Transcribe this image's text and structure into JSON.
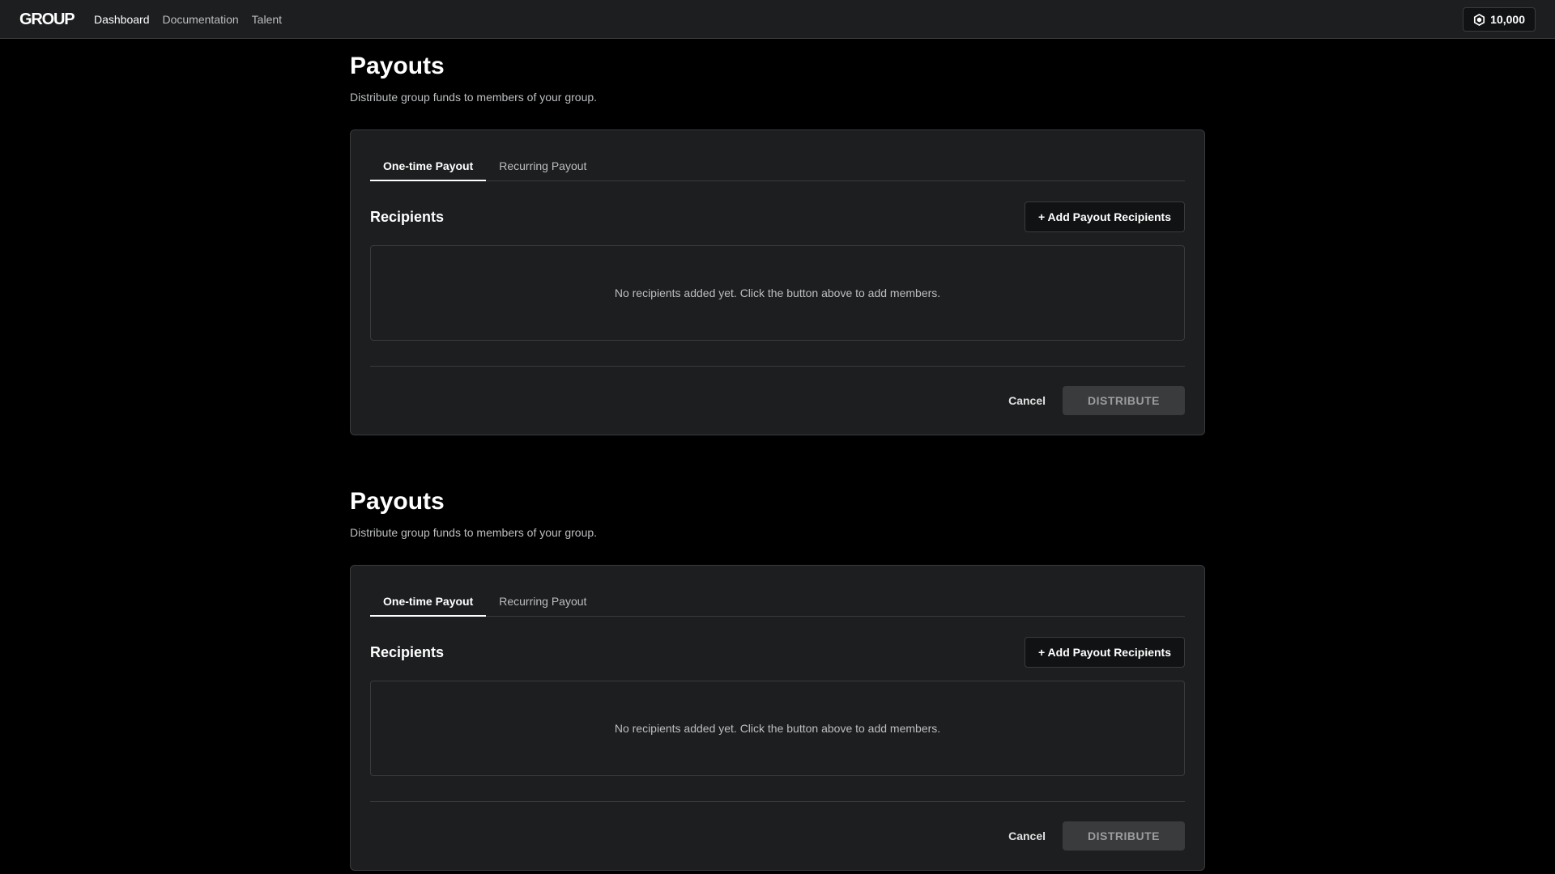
{
  "header": {
    "brand": "GROUP",
    "nav": [
      {
        "label": "Dashboard",
        "active": true
      },
      {
        "label": "Documentation",
        "active": false
      },
      {
        "label": "Talent",
        "active": false
      }
    ],
    "balance": "10,000",
    "balance_icon": "robux-icon"
  },
  "sections": [
    {
      "title": "Payouts",
      "subtitle": "Distribute group funds to members of your group.",
      "tabs": [
        {
          "label": "One-time Payout",
          "active": true
        },
        {
          "label": "Recurring Payout",
          "active": false
        }
      ],
      "recipients_title": "Recipients",
      "add_button": "+ Add Payout Recipients",
      "empty_message": "No recipients added yet. Click the button above to add members.",
      "cancel_label": "Cancel",
      "distribute_label": "DISTRIBUTE"
    },
    {
      "title": "Payouts",
      "subtitle": "Distribute group funds to members of your group.",
      "tabs": [
        {
          "label": "One-time Payout",
          "active": true
        },
        {
          "label": "Recurring Payout",
          "active": false
        }
      ],
      "recipients_title": "Recipients",
      "add_button": "+ Add Payout Recipients",
      "empty_message": "No recipients added yet. Click the button above to add members.",
      "cancel_label": "Cancel",
      "distribute_label": "DISTRIBUTE"
    }
  ],
  "colors": {
    "background": "#000000",
    "surface": "#1d1e20",
    "border": "#393b3d",
    "text_primary": "#ffffff",
    "text_secondary": "#bcbec0",
    "button_disabled_bg": "#393b3d",
    "button_disabled_text": "#9b9d9f"
  }
}
